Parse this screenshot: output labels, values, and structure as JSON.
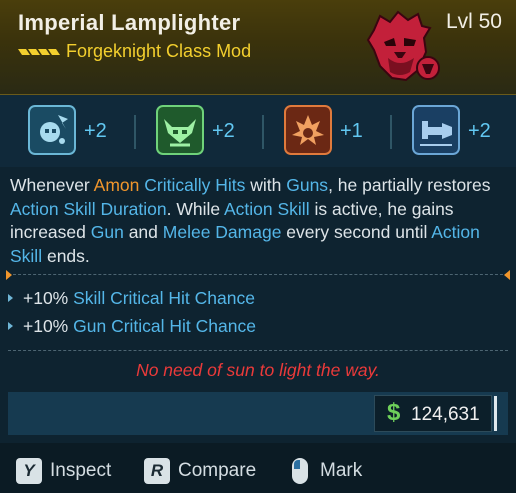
{
  "item": {
    "name": "Imperial Lamplighter",
    "level": "Lvl 50",
    "type": "Forgeknight Class Mod",
    "rarity_color": "#f3cf2e",
    "portrait_icon": "vault-hunter-portrait-icon"
  },
  "bonuses": [
    {
      "icon": "skull-spark-skill-icon",
      "value": "+2",
      "color": "#2c6f8a"
    },
    {
      "icon": "horned-skull-skill-icon",
      "value": "+2",
      "color": "#2f7a3c"
    },
    {
      "icon": "flame-burst-skill-icon",
      "value": "+1",
      "color": "#8a3a1e"
    },
    {
      "icon": "forge-arm-skill-icon",
      "value": "+2",
      "color": "#2c5f8a"
    }
  ],
  "description": {
    "p1": "Whenever ",
    "amon": "Amon",
    "p2": " ",
    "crit_hits": "Critically Hits",
    "p3": " with ",
    "guns": "Guns",
    "p4": ", he partially restores ",
    "asd": "Action Skill Duration",
    "p5": ". While ",
    "as1": "Action Skill",
    "p6": " is active, he gains increased ",
    "gun": "Gun",
    "p7": " and ",
    "melee": "Melee Damage",
    "p8": " every second until ",
    "as2": "Action Skill",
    "p9": " ends."
  },
  "stats": [
    {
      "value": "+10%",
      "name": "Skill Critical Hit Chance"
    },
    {
      "value": "+10%",
      "name": "Gun Critical Hit Chance"
    }
  ],
  "flavor_text": "No need of sun to light the way.",
  "price": {
    "currency_symbol": "$",
    "amount": "124,631"
  },
  "actions": [
    {
      "key": "Y",
      "label": "Inspect"
    },
    {
      "key": "R",
      "label": "Compare"
    },
    {
      "key": "mouse-icon",
      "label": "Mark"
    }
  ]
}
